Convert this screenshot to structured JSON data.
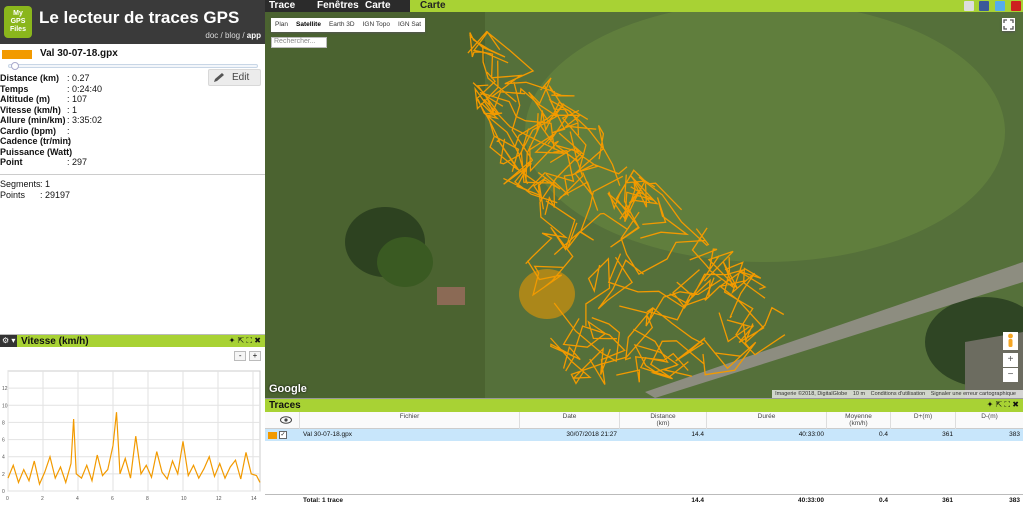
{
  "app": {
    "logo_lines": [
      "My",
      "GPS",
      "Files"
    ],
    "title": "Le lecteur de traces GPS",
    "links": [
      "doc",
      "blog",
      "app"
    ]
  },
  "track": {
    "name": "Val 30-07-18.gpx",
    "color": "#f29a00",
    "edit_label": "Edit",
    "stats": [
      {
        "label": "Distance (km)",
        "value": ": 0.27"
      },
      {
        "label": "Temps",
        "value": ": 0:24:40"
      },
      {
        "label": "Altitude (m)",
        "value": ": 107"
      },
      {
        "label": "Vitesse (km/h)",
        "value": ": 1"
      },
      {
        "label": "Allure (min/km)",
        "value": ": 3:35:02"
      },
      {
        "label": "Cardio (bpm)",
        "value": ":"
      },
      {
        "label": "Cadence (tr/min)",
        "value": ":"
      },
      {
        "label": "Puissance (Watt)",
        "value": ":"
      },
      {
        "label": "Point",
        "value": ": 297"
      }
    ],
    "segments_label": "Segments",
    "segments_value": ": 1",
    "points_label": "Points",
    "points_value": ": 29197"
  },
  "speed_panel": {
    "title": "Vitesse (km/h)",
    "zoom_out": "-",
    "zoom_in": "+"
  },
  "chart_data": {
    "type": "line",
    "title": "Vitesse (km/h)",
    "xlim": [
      0,
      14.4
    ],
    "ylim": [
      0,
      14
    ],
    "x_ticks": [
      0,
      2,
      4,
      6,
      8,
      10,
      12,
      14
    ],
    "y_ticks": [
      0,
      2,
      4,
      6,
      8,
      10,
      12
    ],
    "series": [
      {
        "color": "#f29a00",
        "x": [
          0,
          0.3,
          0.6,
          0.9,
          1.2,
          1.5,
          1.8,
          2.1,
          2.4,
          2.7,
          3.0,
          3.3,
          3.6,
          3.75,
          3.9,
          4.2,
          4.5,
          4.8,
          5.1,
          5.4,
          5.7,
          6.0,
          6.2,
          6.4,
          6.7,
          7.0,
          7.3,
          7.6,
          7.9,
          8.2,
          8.5,
          8.8,
          9.1,
          9.4,
          9.7,
          10.0,
          10.3,
          10.6,
          10.9,
          11.2,
          11.5,
          11.8,
          12.1,
          12.4,
          12.7,
          13.0,
          13.3,
          13.6,
          13.9,
          14.2,
          14.4
        ],
        "y": [
          1.5,
          3,
          1,
          2.5,
          1.2,
          3.5,
          0.8,
          2.2,
          4,
          1.5,
          2.8,
          1,
          3.2,
          8.4,
          2,
          1.5,
          3,
          1.2,
          4.2,
          1.8,
          2.5,
          5.3,
          9.2,
          2,
          3.8,
          1.5,
          6.4,
          2,
          3,
          1.6,
          4.6,
          2.2,
          1.4,
          3.5,
          2,
          5.8,
          1.8,
          3,
          1.5,
          2.6,
          4,
          1.7,
          3.2,
          1.5,
          2.8,
          3.6,
          1.4,
          4.5,
          2,
          1.8,
          1
        ]
      }
    ]
  },
  "menu": {
    "items": [
      "Trace",
      "Fenêtres",
      "Carte"
    ],
    "active_tab": "Carte"
  },
  "map": {
    "layers": [
      "Plan",
      "Satellite",
      "Earth 3D",
      "IGN Topo",
      "IGN Sat"
    ],
    "selected_layer": "Satellite",
    "search_placeholder": "Rechercher...",
    "google": "Google",
    "footer": [
      "Imagerie ©2018, DigitalGlobe",
      "10 m",
      "Conditions d'utilisation",
      "Signaler une erreur cartographique"
    ]
  },
  "traces": {
    "title": "Traces",
    "columns": [
      "Fichier",
      "Date",
      "Distance\n(km)",
      "Durée",
      "Moyenne\n(km/h)",
      "D+(m)",
      "D-(m)"
    ],
    "rows": [
      {
        "file": "Val 30-07-18.gpx",
        "date": "30/07/2018 21:27",
        "distance": "14.4",
        "duration": "40:33:00",
        "mean": "0.4",
        "dplus": "361",
        "dminus": "383"
      }
    ],
    "total": {
      "label": "Total: 1 trace",
      "distance": "14.4",
      "duration": "40:33:00",
      "mean": "0.4",
      "dplus": "361",
      "dminus": "383"
    }
  }
}
